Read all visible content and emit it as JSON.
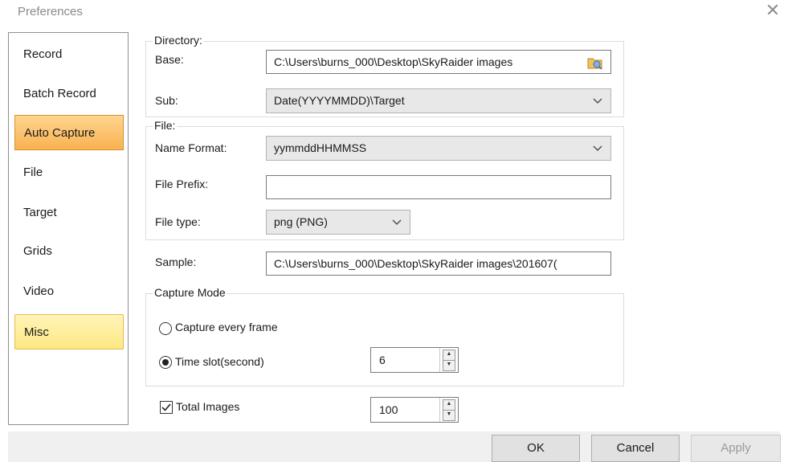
{
  "window": {
    "title": "Preferences",
    "close_glyph": "✕"
  },
  "sidebar": {
    "items": [
      {
        "label": "Record",
        "state": "normal"
      },
      {
        "label": "Batch Record",
        "state": "normal"
      },
      {
        "label": "Auto Capture",
        "state": "selected"
      },
      {
        "label": "File",
        "state": "normal"
      },
      {
        "label": "Target",
        "state": "normal"
      },
      {
        "label": "Grids",
        "state": "normal"
      },
      {
        "label": "Video",
        "state": "normal"
      },
      {
        "label": "Misc",
        "state": "highlighted"
      }
    ]
  },
  "directory": {
    "group_label": "Directory:",
    "base_label": "Base:",
    "base_value": "C:\\Users\\burns_000\\Desktop\\SkyRaider images",
    "browse_icon": "folder-browse-icon",
    "sub_label": "Sub:",
    "sub_value": "Date(YYYYMMDD)\\Target"
  },
  "file": {
    "group_label": "File:",
    "name_format_label": "Name Format:",
    "name_format_value": "yymmddHHMMSS",
    "prefix_label": "File Prefix:",
    "prefix_value": "",
    "type_label": "File type:",
    "type_value": "png (PNG)"
  },
  "sample": {
    "label": "Sample:",
    "value": "C:\\Users\\burns_000\\Desktop\\SkyRaider images\\201607("
  },
  "capture_mode": {
    "group_label": "Capture Mode",
    "every_frame_label": "Capture every frame",
    "every_frame_selected": false,
    "time_slot_label": "Time slot(second)",
    "time_slot_selected": true,
    "time_slot_value": "6"
  },
  "total_images": {
    "label": "Total Images",
    "checked": true,
    "value": "100"
  },
  "buttons": {
    "ok": "OK",
    "cancel": "Cancel",
    "apply": "Apply"
  },
  "colors": {
    "selected_item": "#f8b251",
    "highlight_item": "#fde883",
    "footer_bg": "#f0f0f0"
  }
}
